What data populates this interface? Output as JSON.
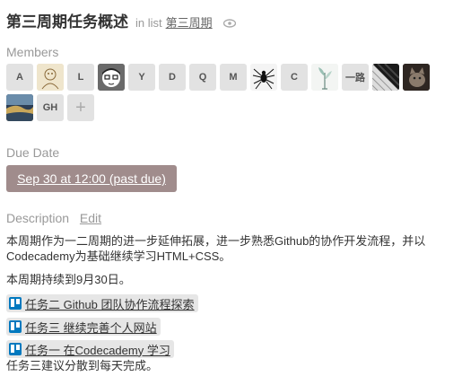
{
  "card": {
    "title": "第三周期任务概述",
    "in_list_prefix": "in list",
    "list_name": "第三周期"
  },
  "members": {
    "label": "Members",
    "items": [
      {
        "initials": "A",
        "kind": "initials"
      },
      {
        "initials": "",
        "kind": "avatar",
        "icon": "sketch-avatar"
      },
      {
        "initials": "L",
        "kind": "initials"
      },
      {
        "initials": "",
        "kind": "avatar",
        "icon": "cartoon-face-avatar"
      },
      {
        "initials": "Y",
        "kind": "initials"
      },
      {
        "initials": "D",
        "kind": "initials"
      },
      {
        "initials": "Q",
        "kind": "initials"
      },
      {
        "initials": "M",
        "kind": "initials"
      },
      {
        "initials": "",
        "kind": "avatar",
        "icon": "spider-avatar"
      },
      {
        "initials": "C",
        "kind": "initials"
      },
      {
        "initials": "",
        "kind": "avatar",
        "icon": "plant-avatar"
      },
      {
        "initials": "一路",
        "kind": "initials"
      },
      {
        "initials": "",
        "kind": "avatar",
        "icon": "piano-avatar"
      },
      {
        "initials": "",
        "kind": "avatar",
        "icon": "cat-avatar"
      },
      {
        "initials": "",
        "kind": "avatar",
        "icon": "landscape-avatar"
      },
      {
        "initials": "GH",
        "kind": "initials"
      },
      {
        "initials": "+",
        "kind": "add"
      }
    ]
  },
  "due": {
    "label": "Due Date",
    "value": "Sep 30 at 12:00 (past due)",
    "color": "#a08c8c"
  },
  "description": {
    "label": "Description",
    "edit_label": "Edit",
    "paragraph1_line1": "本周期作为一二周期的进一步延伸拓展，进一步熟悉Github的协作开发流程，并以",
    "paragraph1_line2": "Codecademy为基础继续学习HTML+CSS。",
    "paragraph2": "本周期持续到9月30日。",
    "tasks": [
      {
        "label": "任务二 Github 团队协作流程探索"
      },
      {
        "label": "任务三 继续完善个人网站"
      },
      {
        "label": "任务一 在Codecademy 学习"
      }
    ],
    "footer": "任务三建议分散到每天完成。"
  }
}
